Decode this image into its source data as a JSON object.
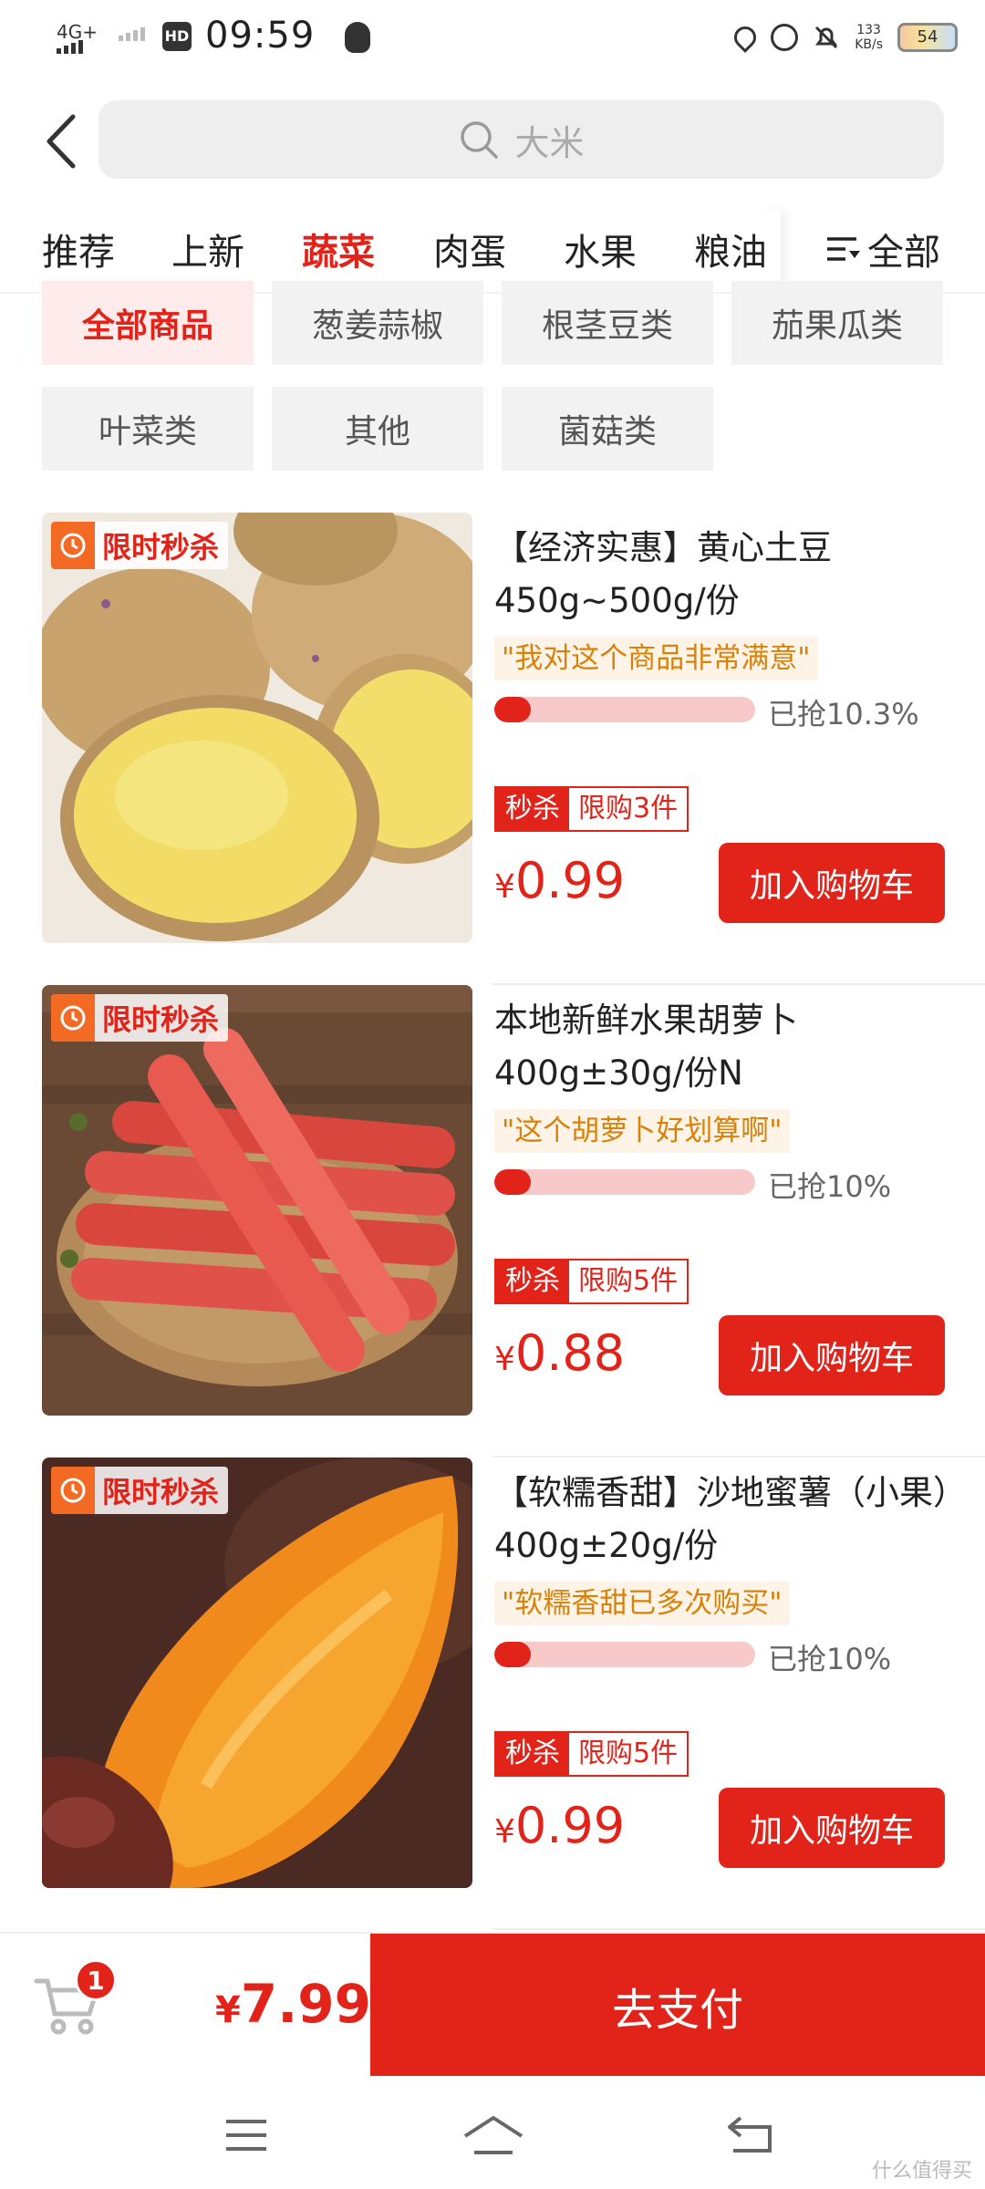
{
  "status_bar": {
    "network": "4G+",
    "hd": "HD",
    "time": "09:59",
    "speed_value": "133",
    "speed_unit": "KB/s",
    "battery": "54"
  },
  "search": {
    "placeholder": "大米"
  },
  "categories": [
    "推荐",
    "上新",
    "蔬菜",
    "肉蛋",
    "水果",
    "粮油"
  ],
  "active_category": "蔬菜",
  "all_label": "全部",
  "subcategories": [
    "全部商品",
    "葱姜蒜椒",
    "根茎豆类",
    "茄果瓜类",
    "叶菜类",
    "其他",
    "菌菇类"
  ],
  "active_subcategory": "全部商品",
  "products": [
    {
      "badge": "限时秒杀",
      "title": "【经济实惠】黄心土豆450g~500g/份",
      "comment": "\"我对这个商品非常满意\"",
      "progress_label": "已抢10.3%",
      "progress": 0.103,
      "seckill": "秒杀",
      "limit": "限购3件",
      "currency": "¥",
      "price": "0.99",
      "add_label": "加入购物车"
    },
    {
      "badge": "限时秒杀",
      "title": "本地新鲜水果胡萝卜400g±30g/份N",
      "comment": "\"这个胡萝卜好划算啊\"",
      "progress_label": "已抢10%",
      "progress": 0.1,
      "seckill": "秒杀",
      "limit": "限购5件",
      "currency": "¥",
      "price": "0.88",
      "add_label": "加入购物车"
    },
    {
      "badge": "限时秒杀",
      "title": "【软糯香甜】沙地蜜薯（小果）400g±20g/份",
      "comment": "\"软糯香甜已多次购买\"",
      "progress_label": "已抢10%",
      "progress": 0.1,
      "seckill": "秒杀",
      "limit": "限购5件",
      "currency": "¥",
      "price": "0.99",
      "add_label": "加入购物车"
    }
  ],
  "cart": {
    "count": "1",
    "currency": "¥",
    "total": "7.99",
    "pay_label": "去支付"
  },
  "watermark": "什么值得买",
  "colors": {
    "accent": "#e2231a",
    "comment_text": "#d9820b",
    "comment_bg": "#fdf3e6",
    "chip_bg": "#f2f2f2",
    "progress_track": "#f8c9c9"
  },
  "icons": [
    "back-icon",
    "search-icon",
    "menu-icon",
    "clock-icon",
    "cart-icon",
    "nav-menu-icon",
    "nav-home-icon",
    "nav-back-icon"
  ]
}
